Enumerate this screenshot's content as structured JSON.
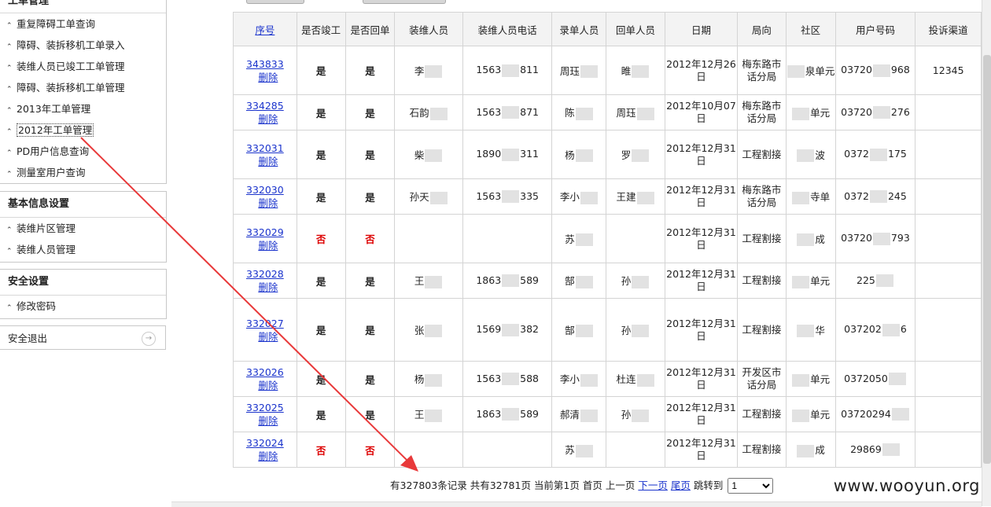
{
  "sidebar": {
    "panel1_title": "工单管理",
    "panel1_items": [
      "重复障碍工单查询",
      "障碍、装拆移机工单录入",
      "装维人员已竣工工单管理",
      "障碍、装拆移机工单管理",
      "2013年工单管理",
      "2012年工单管理",
      "PD用户信息查询",
      "测量室用户查询"
    ],
    "panel2_title": "基本信息设置",
    "panel2_items": [
      "装维片区管理",
      "装维人员管理"
    ],
    "panel3_title": "安全设置",
    "panel3_items": [
      "修改密码"
    ],
    "logout_label": "安全退出"
  },
  "table": {
    "headers": [
      "序号",
      "是否竣工",
      "是否回单",
      "装维人员",
      "装维人员电话",
      "录单人员",
      "回单人员",
      "日期",
      "局向",
      "社区",
      "用户号码",
      "投诉渠道"
    ],
    "delete_label": "删除",
    "rows": [
      {
        "id": "343833",
        "done": "是",
        "returned": "是",
        "staff": "李",
        "phone_a": "1563",
        "phone_b": "811",
        "entry": "周珏",
        "reply": "睢",
        "date": "2012年12月26日",
        "office": "梅东路市话分局",
        "community": "泉单元",
        "user": "03720",
        "user_b": "968",
        "channel": "12345"
      },
      {
        "id": "334285",
        "done": "是",
        "returned": "是",
        "staff": "石韵",
        "phone_a": "1563",
        "phone_b": "871",
        "entry": "陈",
        "reply": "周珏",
        "date": "2012年10月07日",
        "office": "梅东路市话分局",
        "community": "单元",
        "user": "03720",
        "user_b": "276",
        "channel": ""
      },
      {
        "id": "332031",
        "done": "是",
        "returned": "是",
        "staff": "柴",
        "phone_a": "1890",
        "phone_b": "311",
        "entry": "杨",
        "reply": "罗",
        "date": "2012年12月31日",
        "office": "工程割接",
        "community": "波",
        "user": "0372",
        "user_b": "175",
        "channel": ""
      },
      {
        "id": "332030",
        "done": "是",
        "returned": "是",
        "staff": "孙天",
        "phone_a": "1563",
        "phone_b": "335",
        "entry": "李小",
        "reply": "王建",
        "date": "2012年12月31日",
        "office": "梅东路市话分局",
        "community": "寺单",
        "user": "0372",
        "user_b": "245",
        "channel": ""
      },
      {
        "id": "332029",
        "done": "否",
        "returned": "否",
        "staff": "",
        "phone_a": "",
        "phone_b": "",
        "entry": "苏",
        "reply": "",
        "date": "2012年12月31日",
        "office": "工程割接",
        "community": "成",
        "user": "03720",
        "user_b": "793",
        "channel": ""
      },
      {
        "id": "332028",
        "done": "是",
        "returned": "是",
        "staff": "王",
        "phone_a": "1863",
        "phone_b": "589",
        "entry": "郜",
        "reply": "孙",
        "date": "2012年12月31日",
        "office": "工程割接",
        "community": "单元",
        "user": "225",
        "user_b": "",
        "channel": ""
      },
      {
        "id": "332027",
        "done": "是",
        "returned": "是",
        "staff": "张",
        "phone_a": "1569",
        "phone_b": "382",
        "entry": "郜",
        "reply": "孙",
        "date": "2012年12月31日",
        "office": "工程割接",
        "community": "华",
        "user": "037202",
        "user_b": "6",
        "channel": ""
      },
      {
        "id": "332026",
        "done": "是",
        "returned": "是",
        "staff": "杨",
        "phone_a": "1563",
        "phone_b": "588",
        "entry": "李小",
        "reply": "杜连",
        "date": "2012年12月31日",
        "office": "开发区市话分局",
        "community": "单元",
        "user": "0372050",
        "user_b": "",
        "channel": ""
      },
      {
        "id": "332025",
        "done": "是",
        "returned": "是",
        "staff": "王",
        "phone_a": "1863",
        "phone_b": "589",
        "entry": "郝清",
        "reply": "孙",
        "date": "2012年12月31日",
        "office": "工程割接",
        "community": "单元",
        "user": "03720294",
        "user_b": "",
        "channel": ""
      },
      {
        "id": "332024",
        "done": "否",
        "returned": "否",
        "staff": "",
        "phone_a": "",
        "phone_b": "",
        "entry": "苏",
        "reply": "",
        "date": "2012年12月31日",
        "office": "工程割接",
        "community": "成",
        "user": "29869",
        "user_b": "",
        "channel": ""
      }
    ]
  },
  "pager": {
    "summary": "有327803条记录 共有32781页 当前第1页",
    "first": "首页",
    "prev": "上一页",
    "next": "下一页",
    "last": "尾页",
    "jump_label": "跳转到",
    "jump_value": "1"
  },
  "colors": {
    "annotation_arrow": "#e8393a",
    "link": "#1a33cc",
    "no_value": "#dd0000"
  },
  "watermark": "www.wooyun.org"
}
